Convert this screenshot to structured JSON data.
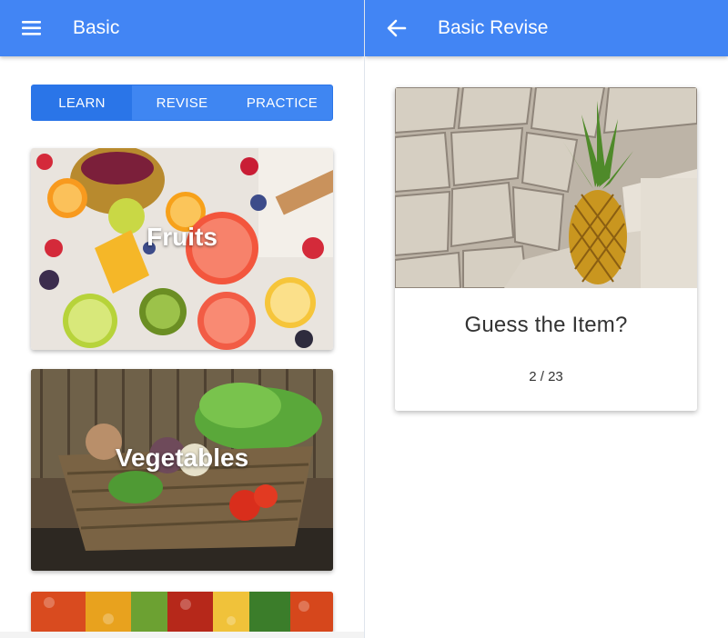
{
  "left_screen": {
    "appbar": {
      "title": "Basic",
      "menu_icon": "hamburger-menu-icon"
    },
    "tabs": [
      {
        "label": "LEARN",
        "active": true
      },
      {
        "label": "REVISE",
        "active": false
      },
      {
        "label": "PRACTICE",
        "active": false
      }
    ],
    "categories": [
      {
        "label": "Fruits"
      },
      {
        "label": "Vegetables"
      },
      {
        "label": ""
      }
    ]
  },
  "right_screen": {
    "appbar": {
      "title": "Basic Revise",
      "back_icon": "arrow-back-icon"
    },
    "quiz": {
      "question": "Guess the Item?",
      "counter": "2 / 23"
    }
  },
  "colors": {
    "primary": "#4285f4",
    "tab_active": "#2a75e8",
    "text_dark": "#333333"
  }
}
